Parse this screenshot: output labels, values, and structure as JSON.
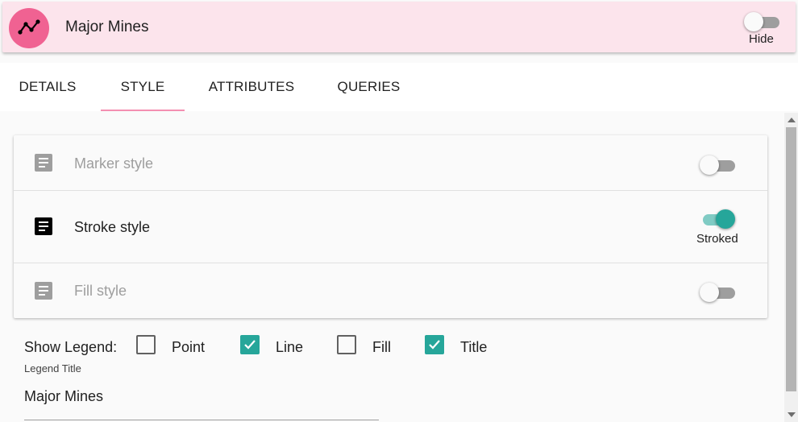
{
  "header": {
    "layer_name": "Major Mines",
    "layer_icon": "polyline-chart-icon",
    "hide_label": "Hide",
    "hide_on": false,
    "accent_color": "#f06292",
    "background_color": "#fce4ec"
  },
  "tabs": [
    {
      "label": "DETAILS",
      "active": false
    },
    {
      "label": "STYLE",
      "active": true
    },
    {
      "label": "ATTRIBUTES",
      "active": false
    },
    {
      "label": "QUERIES",
      "active": false
    }
  ],
  "styles": [
    {
      "label": "Marker style",
      "enabled": false,
      "icon": "description-icon",
      "status": ""
    },
    {
      "label": "Stroke style",
      "enabled": true,
      "icon": "description-icon",
      "status": "Stroked"
    },
    {
      "label": "Fill style",
      "enabled": false,
      "icon": "description-icon",
      "status": ""
    }
  ],
  "legend": {
    "show_legend_label": "Show Legend:",
    "options": [
      {
        "label": "Point",
        "checked": false
      },
      {
        "label": "Line",
        "checked": true
      },
      {
        "label": "Fill",
        "checked": false
      },
      {
        "label": "Title",
        "checked": true
      }
    ],
    "title_field_label": "Legend Title",
    "title_value": "Major Mines"
  },
  "theme": {
    "toggle_on_color": "#26a69a",
    "checkbox_color": "#26a69a",
    "tab_indicator_color": "#f48fb1"
  }
}
